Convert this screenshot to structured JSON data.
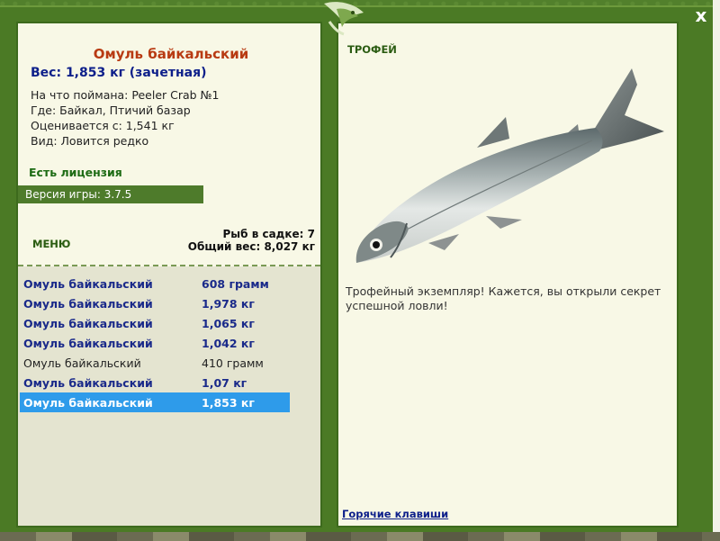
{
  "window": {
    "close_label": "x"
  },
  "left_panel": {
    "fish_name": "Омуль байкальский",
    "weight_line": "Вес: 1,853 кг (зачетная)",
    "info": {
      "bait": "На что поймана: Peeler Crab №1",
      "location": "Где: Байкал, Птичий базар",
      "value": "Оценивается с: 1,541 кг",
      "kind": "Вид: Ловится редко"
    },
    "license": "Есть лицензия",
    "version": "Версия игры: 3.7.5",
    "menu_label": "МЕНЮ",
    "stats": {
      "fish_in_cage": "Рыб в садке: 7",
      "total_weight": "Общий вес: 8,027 кг"
    },
    "catch_list": [
      {
        "name": "Омуль байкальский",
        "weight": "608 грамм"
      },
      {
        "name": "Омуль байкальский",
        "weight": "1,978 кг"
      },
      {
        "name": "Омуль байкальский",
        "weight": "1,065 кг"
      },
      {
        "name": "Омуль байкальский",
        "weight": "1,042 кг"
      },
      {
        "name": "Омуль байкальский",
        "weight": "410 грамм"
      },
      {
        "name": "Омуль байкальский",
        "weight": "1,07 кг"
      },
      {
        "name": "Омуль байкальский",
        "weight": "1,853 кг"
      }
    ]
  },
  "right_panel": {
    "trophy_label": "ТРОФЕЙ",
    "trophy_text": "Трофейный экземпляр! Кажется, вы открыли секрет успешной ловли!",
    "hotkeys_link": "Горячие клавиши"
  },
  "colors": {
    "frame": "#4b7a25",
    "panel": "#f8f8e6",
    "title": "#b83a12",
    "link": "#0d1f8a",
    "selected": "#2e9bea"
  },
  "icons": {
    "logo": "fish-leaf-logo-icon",
    "close": "close-icon"
  }
}
